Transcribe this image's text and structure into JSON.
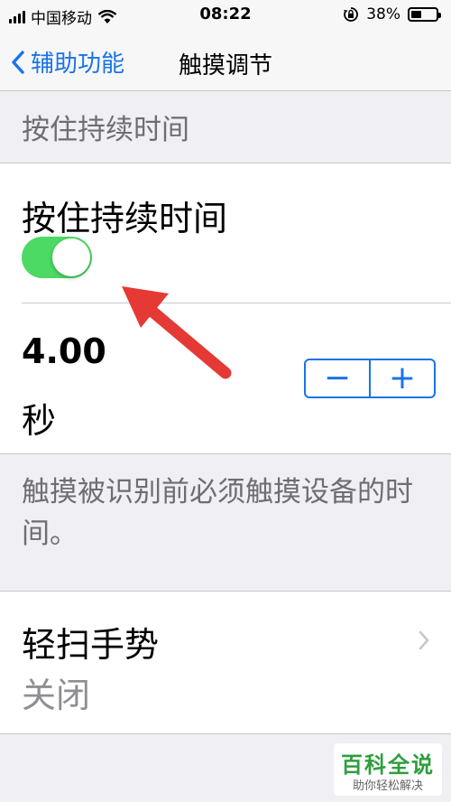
{
  "status": {
    "carrier": "中国移动",
    "time": "08:22",
    "battery": "38%"
  },
  "nav": {
    "back_label": "辅助功能",
    "title": "触摸调节"
  },
  "section": {
    "header": "按住持续时间"
  },
  "hold_duration": {
    "label": "按住持续时间",
    "enabled": true,
    "value": "4.00",
    "unit": "秒",
    "minus": "−",
    "plus": "+"
  },
  "footer_note": "触摸被识别前必须触摸设备的时间。",
  "swipe_gestures": {
    "title": "轻扫手势",
    "status": "关闭"
  },
  "watermark": {
    "title": "百科全说",
    "subtitle": "助你轻松解决"
  },
  "colors": {
    "accent": "#1a73e8",
    "toggle_on": "#4cd964",
    "arrow": "#e53935"
  },
  "icons": [
    "signal-icon",
    "wifi-icon",
    "orientation-lock-icon",
    "battery-icon",
    "back-chevron-icon",
    "chevron-right-icon"
  ]
}
